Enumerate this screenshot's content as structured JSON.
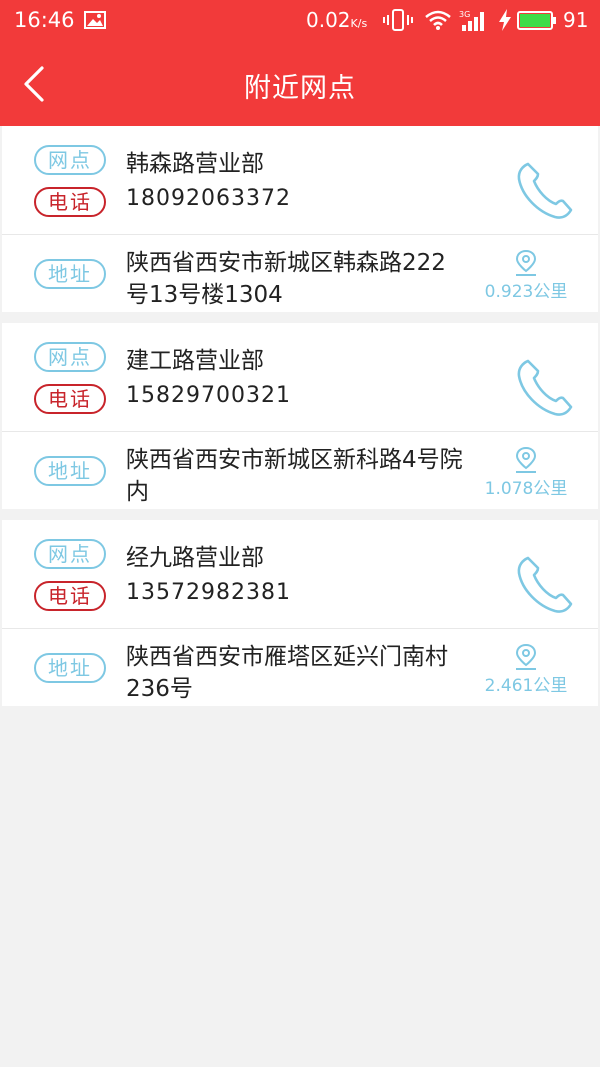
{
  "status_bar": {
    "time": "16:46",
    "net_speed": "0.02",
    "net_unit": "K/s",
    "battery": "91",
    "icons": [
      "image-icon",
      "vibrate-icon",
      "wifi-icon",
      "signal-3g-icon",
      "charging-icon",
      "battery-icon"
    ]
  },
  "app_bar": {
    "title": "附近网点",
    "back_icon": "chevron-left-icon"
  },
  "labels": {
    "outlet": "网点",
    "phone": "电话",
    "address": "地址"
  },
  "outlets": [
    {
      "name": "韩森路营业部",
      "phone": "18092063372",
      "address": "陕西省西安市新城区韩森路222号13号楼1304",
      "distance": "0.923公里"
    },
    {
      "name": "建工路营业部",
      "phone": "15829700321",
      "address": "陕西省西安市新城区新科路4号院内",
      "distance": "1.078公里"
    },
    {
      "name": "经九路营业部",
      "phone": "13572982381",
      "address": "陕西省西安市雁塔区延兴门南村236号",
      "distance": "2.461公里"
    }
  ],
  "colors": {
    "primary": "#f23a3a",
    "tag_blue": "#7ec8e3",
    "tag_red": "#c8242b",
    "background": "#f2f2f2"
  }
}
